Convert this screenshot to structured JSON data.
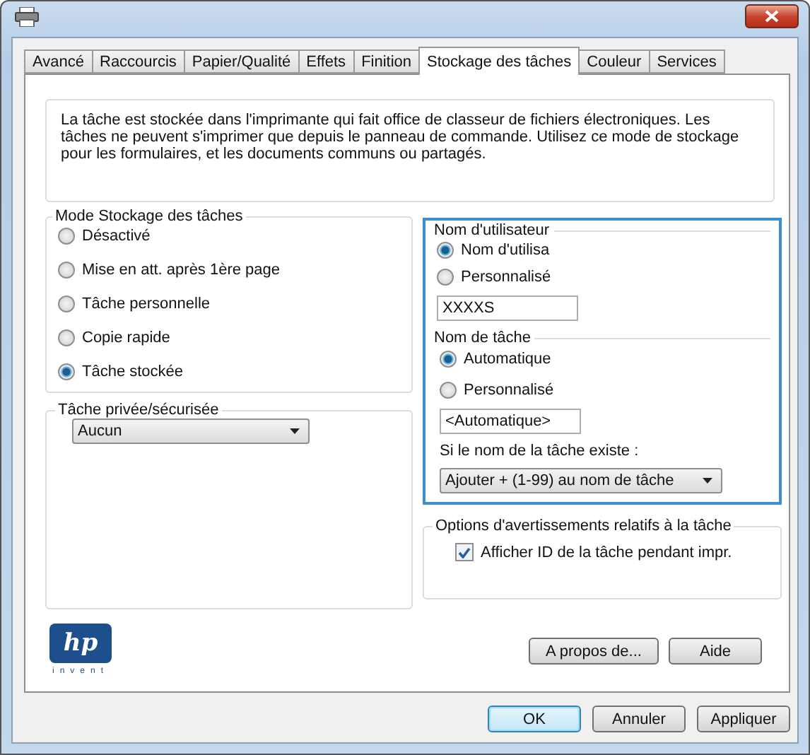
{
  "tabs": [
    {
      "label": "Avancé",
      "selected": false
    },
    {
      "label": "Raccourcis",
      "selected": false
    },
    {
      "label": "Papier/Qualité",
      "selected": false
    },
    {
      "label": "Effets",
      "selected": false
    },
    {
      "label": "Finition",
      "selected": false
    },
    {
      "label": "Stockage des tâches",
      "selected": true
    },
    {
      "label": "Couleur",
      "selected": false
    },
    {
      "label": "Services",
      "selected": false
    }
  ],
  "description": "La tâche est stockée dans l'imprimante qui fait office de classeur de fichiers électroniques. Les tâches ne peuvent s'imprimer que depuis le panneau de commande. Utilisez ce mode de stockage pour les formulaires, et les documents communs ou partagés.",
  "storage_mode": {
    "legend": "Mode Stockage des tâches",
    "options": [
      {
        "label": "Désactivé",
        "selected": false
      },
      {
        "label": "Mise en att. après 1ère page",
        "selected": false
      },
      {
        "label": "Tâche personnelle",
        "selected": false
      },
      {
        "label": "Copie rapide",
        "selected": false
      },
      {
        "label": "Tâche stockée",
        "selected": true
      }
    ]
  },
  "private_job": {
    "legend": "Tâche privée/sécurisée",
    "dropdown": "Aucun"
  },
  "user_name": {
    "legend": "Nom d'utilisateur",
    "options": [
      {
        "label": "Nom d'utilisa",
        "selected": true
      },
      {
        "label": "Personnalisé",
        "selected": false
      }
    ],
    "field_value": "XXXXS"
  },
  "job_name": {
    "legend": "Nom de tâche",
    "options": [
      {
        "label": "Automatique",
        "selected": true
      },
      {
        "label": "Personnalisé",
        "selected": false
      }
    ],
    "field_value": "<Automatique>",
    "exists_label": "Si le nom de la tâche existe :",
    "exists_dropdown": "Ajouter + (1-99) au nom de tâche"
  },
  "warnings": {
    "legend": "Options d'avertissements relatifs à la tâche",
    "checkbox": {
      "label": "Afficher ID de la tâche pendant impr.",
      "checked": true
    }
  },
  "logo": {
    "mark": "hp",
    "tagline": "invent"
  },
  "panel_buttons": [
    "A propos de...",
    "Aide"
  ],
  "dialog_buttons": [
    {
      "label": "OK",
      "default": true
    },
    {
      "label": "Annuler",
      "default": false
    },
    {
      "label": "Appliquer",
      "default": false
    }
  ]
}
